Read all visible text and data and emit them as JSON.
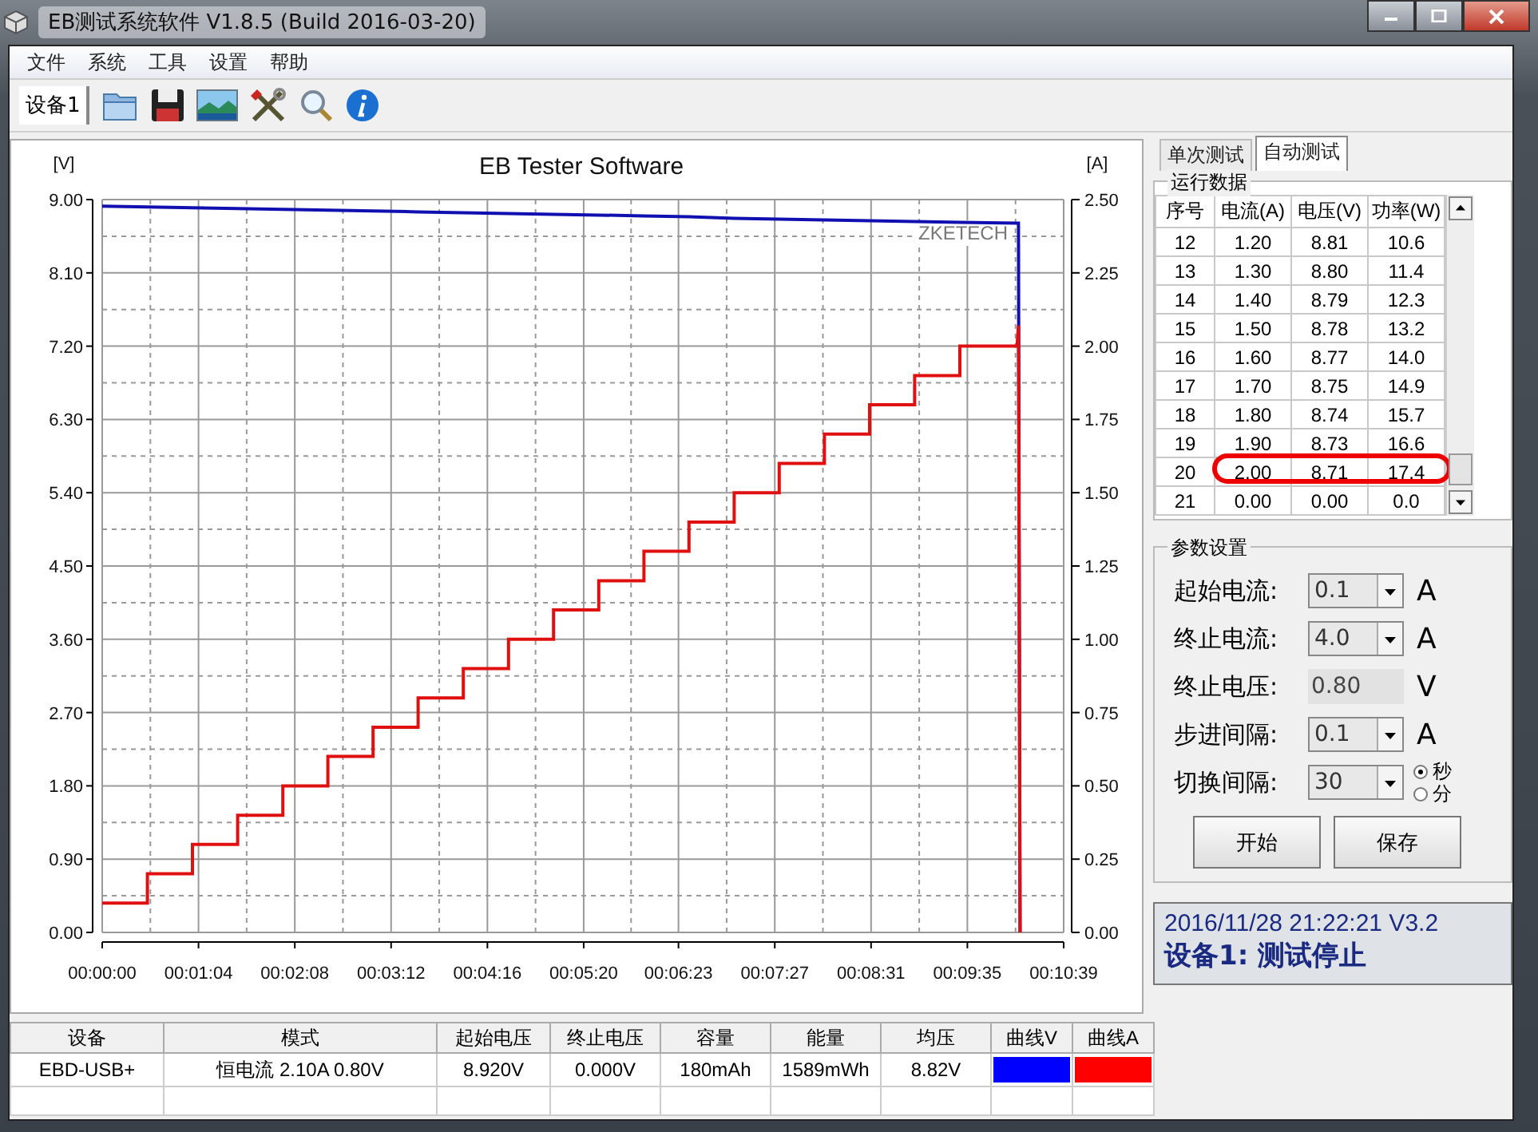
{
  "window": {
    "title": "EB测试系统软件 V1.8.5 (Build 2016-03-20)"
  },
  "menu": [
    "文件",
    "系统",
    "工具",
    "设置",
    "帮助"
  ],
  "toolbar": {
    "device_tab": "设备1"
  },
  "chart": {
    "watermark": "ZKETECH",
    "chart_data": {
      "type": "line",
      "title": "EB Tester Software",
      "ylabel": "[V]",
      "y2label": "[A]",
      "grid": true,
      "y2lim": [
        0,
        2.5
      ],
      "y2ticks": [
        {
          "value": 0,
          "label": "0.00"
        },
        {
          "value": 0.25,
          "label": "0.25"
        },
        {
          "value": 0.5,
          "label": "0.50"
        },
        {
          "value": 0.75,
          "label": "0.75"
        },
        {
          "value": 1,
          "label": "1.00"
        },
        {
          "value": 1.25,
          "label": "1.25"
        },
        {
          "value": 1.5,
          "label": "1.50"
        },
        {
          "value": 1.75,
          "label": "1.75"
        },
        {
          "value": 2,
          "label": "2.00"
        },
        {
          "value": 2.25,
          "label": "2.25"
        },
        {
          "value": 2.5,
          "label": "2.50"
        }
      ],
      "x": [
        0,
        30,
        30,
        60,
        60,
        90,
        90,
        120,
        120,
        150,
        150,
        180,
        180,
        210,
        210,
        240,
        240,
        270,
        270,
        300,
        300,
        330,
        330,
        360,
        360,
        390,
        390,
        420,
        420,
        450,
        450,
        480,
        480,
        510,
        510,
        540,
        540,
        570,
        570,
        608,
        609,
        610
      ],
      "xlim": [
        0,
        639
      ],
      "xticks": [
        {
          "value": 0,
          "label": "00:00:00"
        },
        {
          "value": 64,
          "label": "00:01:04"
        },
        {
          "value": 128,
          "label": "00:02:08"
        },
        {
          "value": 192,
          "label": "00:03:12"
        },
        {
          "value": 256,
          "label": "00:04:16"
        },
        {
          "value": 320,
          "label": "00:05:20"
        },
        {
          "value": 383,
          "label": "00:06:23"
        },
        {
          "value": 447,
          "label": "00:07:27"
        },
        {
          "value": 511,
          "label": "00:08:31"
        },
        {
          "value": 575,
          "label": "00:09:35"
        },
        {
          "value": 639,
          "label": "00:10:39"
        }
      ],
      "ylim": [
        0,
        9
      ],
      "yticks": [
        {
          "value": 0,
          "label": "0.00"
        },
        {
          "value": 0.9,
          "label": "0.90"
        },
        {
          "value": 1.8,
          "label": "1.80"
        },
        {
          "value": 2.7,
          "label": "2.70"
        },
        {
          "value": 3.6,
          "label": "3.60"
        },
        {
          "value": 4.5,
          "label": "4.50"
        },
        {
          "value": 5.4,
          "label": "5.40"
        },
        {
          "value": 6.3,
          "label": "6.30"
        },
        {
          "value": 7.2,
          "label": "7.20"
        },
        {
          "value": 8.1,
          "label": "8.10"
        },
        {
          "value": 9,
          "label": "9.00"
        }
      ],
      "series": [
        {
          "color": "#1010b0",
          "values": [
            8.92,
            8.91,
            8.91,
            8.9,
            8.9,
            8.89,
            8.89,
            8.88,
            8.88,
            8.87,
            8.87,
            8.86,
            8.86,
            8.85,
            8.85,
            8.84,
            8.84,
            8.83,
            8.83,
            8.82,
            8.82,
            8.81,
            8.81,
            8.8,
            8.8,
            8.79,
            8.79,
            8.77,
            8.77,
            8.76,
            8.76,
            8.75,
            8.75,
            8.74,
            8.74,
            8.73,
            8.73,
            8.72,
            8.72,
            8.71,
            8.71,
            0
          ]
        },
        {
          "axis": "y2",
          "color": "#e01010",
          "values": [
            0.1,
            0.1,
            0.2,
            0.2,
            0.3,
            0.3,
            0.4,
            0.4,
            0.5,
            0.5,
            0.6,
            0.6,
            0.7,
            0.7,
            0.8,
            0.8,
            0.9,
            0.9,
            1.0,
            1.0,
            1.1,
            1.1,
            1.2,
            1.2,
            1.3,
            1.3,
            1.4,
            1.4,
            1.5,
            1.5,
            1.6,
            1.6,
            1.7,
            1.7,
            1.8,
            1.8,
            1.9,
            1.9,
            2.0,
            2.0,
            2.07,
            0
          ]
        }
      ]
    }
  },
  "summary": {
    "columns": [
      "设备",
      "模式",
      "起始电压",
      "终止电压",
      "容量",
      "能量",
      "均压",
      "曲线V",
      "曲线A"
    ],
    "row": {
      "device": "EBD-USB+",
      "mode": "恒电流  2.10A  0.80V",
      "start_voltage": "8.920V",
      "end_voltage": "0.000V",
      "capacity": "180mAh",
      "energy": "1589mWh",
      "avg_voltage": "8.82V",
      "curves": [
        {
          "color": "#0000ff"
        },
        {
          "color": "#ff0000"
        }
      ]
    }
  },
  "tabs": [
    {
      "label": "单次测试",
      "selected": false
    },
    {
      "label": "自动测试",
      "selected": true
    }
  ],
  "run_data": {
    "title": "运行数据",
    "columns": [
      "序号",
      "电流(A)",
      "电压(V)",
      "功率(W)"
    ],
    "rows": [
      {
        "cells": [
          "12",
          "1.20",
          "8.81",
          "10.6"
        ],
        "circled": false
      },
      {
        "cells": [
          "13",
          "1.30",
          "8.80",
          "11.4"
        ],
        "circled": false
      },
      {
        "cells": [
          "14",
          "1.40",
          "8.79",
          "12.3"
        ],
        "circled": false
      },
      {
        "cells": [
          "15",
          "1.50",
          "8.78",
          "13.2"
        ],
        "circled": false
      },
      {
        "cells": [
          "16",
          "1.60",
          "8.77",
          "14.0"
        ],
        "circled": false
      },
      {
        "cells": [
          "17",
          "1.70",
          "8.75",
          "14.9"
        ],
        "circled": false
      },
      {
        "cells": [
          "18",
          "1.80",
          "8.74",
          "15.7"
        ],
        "circled": false
      },
      {
        "cells": [
          "19",
          "1.90",
          "8.73",
          "16.6"
        ],
        "circled": false
      },
      {
        "cells": [
          "20",
          "2.00",
          "8.71",
          "17.4"
        ],
        "circled": true
      },
      {
        "cells": [
          "21",
          "0.00",
          "0.00",
          "0.0"
        ],
        "circled": false
      }
    ]
  },
  "params": {
    "title": "参数设置",
    "fields": [
      {
        "kind": "dropdown",
        "label": "起始电流:",
        "value": "0.1",
        "unit": "A"
      },
      {
        "kind": "dropdown",
        "label": "终止电流:",
        "value": "4.0",
        "unit": "A"
      },
      {
        "kind": "text",
        "label": "终止电压:",
        "value": "0.80",
        "unit": "V"
      },
      {
        "kind": "dropdown",
        "label": "步进间隔:",
        "value": "0.1",
        "unit": "A"
      },
      {
        "kind": "dropdown",
        "label": "切换间隔:",
        "value": "30",
        "options": [
          {
            "label": "秒",
            "selected": true
          },
          {
            "label": "分",
            "selected": false
          }
        ]
      }
    ],
    "buttons": [
      "开始",
      "保存"
    ]
  },
  "status": {
    "line1": "2016/11/28 21:22:21  V3.2",
    "line2": "设备1: 测试停止"
  }
}
